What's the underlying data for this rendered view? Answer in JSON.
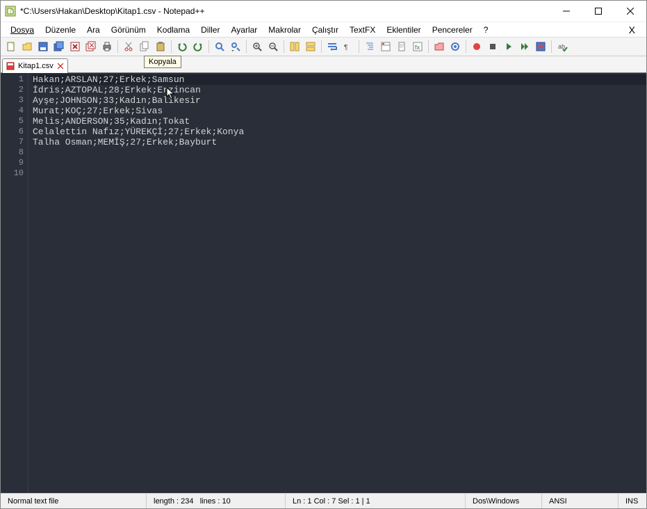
{
  "title": "*C:\\Users\\Hakan\\Desktop\\Kitap1.csv - Notepad++",
  "menus": [
    "Dosya",
    "Düzenle",
    "Ara",
    "Görünüm",
    "Kodlama",
    "Diller",
    "Ayarlar",
    "Makrolar",
    "Çalıştır",
    "TextFX",
    "Eklentiler",
    "Pencereler",
    "?"
  ],
  "tooltip": "Kopyala",
  "tab": {
    "label": "Kitap1.csv"
  },
  "lines": [
    "Hakan;ARSLAN;27;Erkek;Samsun",
    "İdris;AZTOPAL;28;Erkek;Erzincan",
    "Ayşe;JOHNSON;33;Kadın;Balıkesir",
    "Murat;KOÇ;27;Erkek;Sivas",
    "Melis;ANDERSON;35;Kadın;Tokat",
    "Celalettin Nafız;YÜREKÇİ;27;Erkek;Konya",
    "Talha Osman;MEMİŞ;27;Erkek;Bayburt",
    "",
    "",
    ""
  ],
  "status": {
    "filetype": "Normal text file",
    "length_label": "length :",
    "length": "234",
    "lines_label": "lines :",
    "lines": "10",
    "pos": "Ln : 1    Col : 7    Sel : 1 | 1",
    "eol": "Dos\\Windows",
    "encoding": "ANSI",
    "mode": "INS"
  },
  "toolbar_icons": [
    "new-file-icon",
    "open-file-icon",
    "save-icon",
    "save-all-icon",
    "close-icon",
    "close-all-icon",
    "print-icon",
    "sep",
    "cut-icon",
    "copy-icon",
    "paste-icon",
    "sep",
    "undo-icon",
    "redo-icon",
    "sep",
    "find-icon",
    "replace-icon",
    "sep",
    "zoom-in-icon",
    "zoom-out-icon",
    "sep",
    "sync-v-icon",
    "sync-h-icon",
    "sep",
    "wordwrap-icon",
    "all-chars-icon",
    "sep",
    "indent-guide-icon",
    "lang-panel-icon",
    "doc-map-icon",
    "func-list-icon",
    "sep",
    "folder-icon",
    "monitor-icon",
    "sep",
    "record-icon",
    "stop-icon",
    "play-icon",
    "play-multi-icon",
    "save-macro-icon",
    "sep",
    "spell-icon"
  ]
}
